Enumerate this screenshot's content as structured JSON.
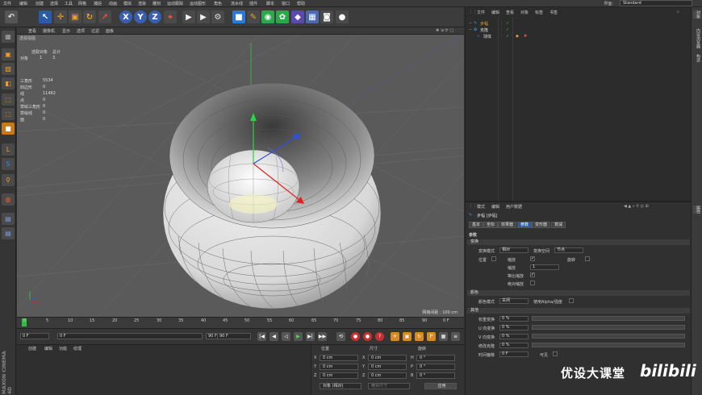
{
  "menu": [
    "文件",
    "编辑",
    "创建",
    "选择",
    "工具",
    "网格",
    "捕捉",
    "动画",
    "模拟",
    "渲染",
    "雕刻",
    "运动跟踪",
    "运动图形",
    "角色",
    "流水线",
    "插件",
    "脚本",
    "窗口",
    "帮助"
  ],
  "layout": {
    "label": "界面:",
    "value": "Standard"
  },
  "toolbar_icons": [
    "undo-icon",
    "live-select-icon",
    "move-icon",
    "scale-icon",
    "rotate-icon",
    "recent-tool-icon",
    "x-axis-icon",
    "y-axis-icon",
    "z-axis-icon",
    "coordinate-system-icon",
    "render-view-icon",
    "render-picture-viewer-icon",
    "edit-render-settings-icon",
    "cube-icon",
    "pen-icon",
    "subdivision-surface-icon",
    "array-icon",
    "bend-deformer-icon",
    "floor-icon",
    "camera-icon",
    "light-icon"
  ],
  "viewport_menu": [
    "查看",
    "摄像机",
    "显示",
    "选项",
    "过滤",
    "面板"
  ],
  "viewport": {
    "title": "透视视图",
    "selected_label": "选取对象",
    "total_label": "总计",
    "objects_label": "对象",
    "objects_selected": "1",
    "objects_total": "3",
    "stats": [
      {
        "label": "三角形",
        "value": "5534"
      },
      {
        "label": "四边形",
        "value": "0"
      },
      {
        "label": "线",
        "value": "11482"
      },
      {
        "label": "点",
        "value": "0"
      },
      {
        "label": "草绘三角形",
        "value": "0"
      },
      {
        "label": "草绘线",
        "value": "0"
      },
      {
        "label": "面",
        "value": "0"
      }
    ],
    "grid_spacing": "网格间距 : 100 cm"
  },
  "timeline": {
    "ticks": [
      "0",
      "5",
      "10",
      "15",
      "20",
      "25",
      "30",
      "35",
      "40",
      "45",
      "50",
      "55",
      "60",
      "65",
      "70",
      "75",
      "80",
      "85",
      "90"
    ],
    "current_frame": "0 F",
    "start": "0 F",
    "range_start": "0 F",
    "range_end": "90 F",
    "end": "90 F"
  },
  "material_menu": [
    "创建",
    "编辑",
    "功能",
    "纹理"
  ],
  "coords": {
    "headers": [
      "位置",
      "尺寸",
      "旋转"
    ],
    "rows": [
      {
        "axis": "X",
        "pos": "0 cm",
        "size": "0 cm",
        "rot_label": "H",
        "rot": "0 °"
      },
      {
        "axis": "Y",
        "pos": "0 cm",
        "size": "0 cm",
        "rot_label": "P",
        "rot": "0 °"
      },
      {
        "axis": "Z",
        "pos": "0 cm",
        "size": "0 cm",
        "rot_label": "B",
        "rot": "0 °"
      }
    ],
    "mode": "对象 (相对)",
    "size_mode": "绝对尺寸",
    "apply": "应用"
  },
  "object_menu": [
    "文件",
    "编辑",
    "查看",
    "对象",
    "标签",
    "书签"
  ],
  "objects": [
    {
      "name": "步幅",
      "indent": 0
    },
    {
      "name": "克隆",
      "indent": 0
    },
    {
      "name": "球体",
      "indent": 1
    }
  ],
  "attr_menu": [
    "模式",
    "编辑",
    "用户数据"
  ],
  "attr": {
    "object_name": "步幅 [步幅]",
    "tabs": [
      "基本",
      "坐标",
      "效果器",
      "参数",
      "变形器",
      "衰减"
    ],
    "active_tab": "参数",
    "params_title": "参数",
    "sec_transform": "变换",
    "transform_mode_label": "变换模式",
    "transform_mode": "相对",
    "transform_space_label": "变换空间",
    "transform_space": "节点",
    "position_label": "位置",
    "scale_label": "缩放",
    "rotation_label": "旋转",
    "scale_value_label": "缩放",
    "scale_value": "1",
    "uniform_scale_label": "等比缩放",
    "absolute_scale_label": "绝对缩放",
    "sec_color": "颜色",
    "color_mode_label": "颜色模式",
    "color_mode": "关闭",
    "use_alpha_label": "使用Alpha/强度",
    "sec_other": "其他",
    "weight_label": "权重变换",
    "weight": "0 %",
    "u_label": "U 向变换",
    "u": "0 %",
    "v_label": "V 向变换",
    "v": "0 %",
    "modify_label": "修改克隆",
    "modify": "0 %",
    "time_label": "时间偏移",
    "time": "0 F",
    "visible_label": "可见"
  },
  "right_tabs": [
    "对象",
    "内容浏览器",
    "构造",
    "属性"
  ],
  "watermark": "优设大课堂",
  "watermark_logo": "bilibili",
  "brand": "MAXON CINEMA 4D"
}
